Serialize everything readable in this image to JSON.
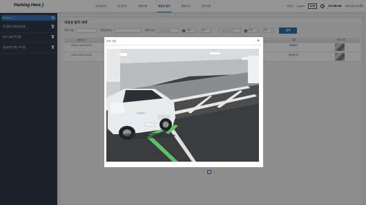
{
  "header": {
    "logo": "Parking Here",
    "nav": [
      "주차장관리",
      "장나관리",
      "차량조회",
      "에정상 탐지",
      "결제수단",
      "공지사항"
    ],
    "active_nav_index": 3,
    "user_name": "관리자",
    "logout_label": "Logout",
    "lang_button": "KOR",
    "clock_time": "14:38:26",
    "clock_date": "2021-09-16 (목)"
  },
  "sidebar": {
    "search_placeholder": "Search...",
    "items": [
      {
        "label": "한국판도 폐지미정계",
        "icon": "trash-icon"
      },
      {
        "label": "판교 교령 주차장",
        "icon": "trash-icon"
      },
      {
        "label": "경남지역 센터 주차장",
        "icon": "trash-icon"
      }
    ]
  },
  "main": {
    "title": "비정상 탐지 내역",
    "filters": {
      "car_number_label": "차량 번호",
      "anomaly_label": "비정상타입",
      "period_label": "날짜/시간",
      "start_date": "2020-09-01",
      "start_hour": "00",
      "start_minute": "00",
      "end_date": "2021-09-15",
      "end_hour": "23",
      "end_minute": "59",
      "search_button": "검색"
    },
    "table": {
      "headers": [
        "발생시간",
        "위치",
        "유형",
        "주차 사진"
      ],
      "rows": [
        {
          "time": "2020-12-30 13:02:33",
          "location": "",
          "type": "예외탐지"
        },
        {
          "time": "2020-12-30 07:49:02",
          "location": "",
          "type": "비정상주차"
        }
      ]
    },
    "pagination": {
      "prev": "‹",
      "current": "1",
      "next": "›"
    }
  },
  "modal": {
    "title": "주차 사진",
    "close_icon": "close-icon",
    "photo_description": "parking-lot-photo"
  }
}
